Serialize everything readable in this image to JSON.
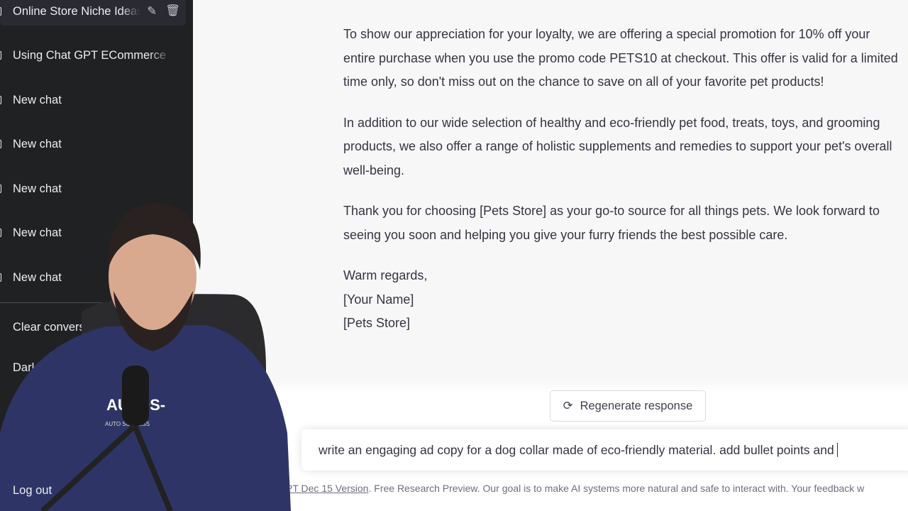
{
  "sidebar": {
    "items": [
      {
        "label": "Online Store Niche Ideas",
        "active": true
      },
      {
        "label": "Using Chat GPT ECommerce"
      },
      {
        "label": "New chat"
      },
      {
        "label": "New chat"
      },
      {
        "label": "New chat"
      },
      {
        "label": "New chat"
      },
      {
        "label": "New chat"
      }
    ],
    "clear": "Clear conversations",
    "dark": "Dark mode",
    "logout": "Log out"
  },
  "message": {
    "paragraphs": [
      "To show our appreciation for your loyalty, we are offering a special promotion for 10% off your entire purchase when you use the promo code PETS10 at checkout. This offer is valid for a limited time only, so don't miss out on the chance to save on all of your favorite pet products!",
      "In addition to our wide selection of healthy and eco-friendly pet food, treats, toys, and grooming products, we also offer a range of holistic supplements and remedies to support your pet's overall well-being.",
      "Thank you for choosing [Pets Store] as your go-to source for all things pets. We look forward to seeing you soon and helping you give your furry friends the best possible care."
    ],
    "signoff": [
      "Warm regards,",
      "[Your Name]",
      "[Pets Store]"
    ]
  },
  "regenerate": "Regenerate response",
  "input": {
    "value": "write an engaging ad copy for a dog collar made of eco-friendly material. add bullet points and"
  },
  "footer": {
    "link": "PT Dec 15 Version",
    "text": ". Free Research Preview. Our goal is to make AI systems more natural and safe to interact with. Your feedback w"
  },
  "webcam": {
    "shirt_text": "AU -DS-",
    "shirt_sub": "AUTO   SUCCESS"
  }
}
